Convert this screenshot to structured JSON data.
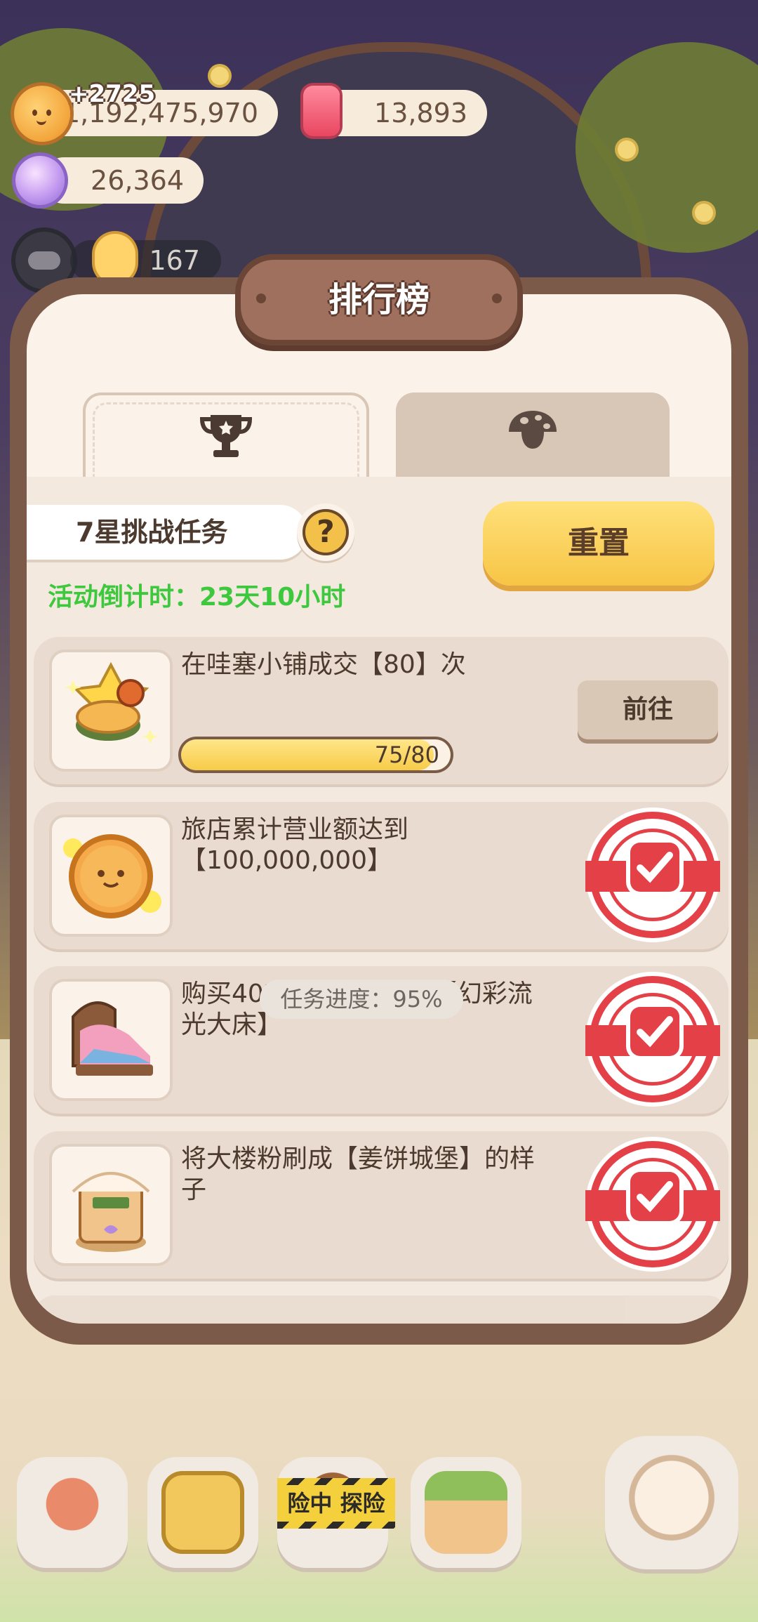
{
  "resources": {
    "coins": "1,192,475,970",
    "coin_gain": "+2725",
    "candles": "13,893",
    "gems": "26,364",
    "badge_count": "167"
  },
  "dialog": {
    "title": "排行榜",
    "tabs": [
      {
        "icon": "trophy-icon"
      },
      {
        "icon": "mushroom-icon"
      }
    ],
    "challenge": {
      "label": "7星挑战任务",
      "help": "?",
      "countdown": "活动倒计时：23天10小时",
      "reset_label": "重置"
    },
    "tasks": [
      {
        "desc": "在哇塞小铺成交【80】次",
        "action": "前往",
        "progress_text": "75/80",
        "progress": 0.9375,
        "status": "in-progress"
      },
      {
        "desc": "旅店累计营业额达到【100,000,000】",
        "status": "completed"
      },
      {
        "desc": "购买402号客房的家具【幻彩流光大床】",
        "status": "completed"
      },
      {
        "desc": "将大楼粉刷成【姜饼城堡】的样子",
        "status": "completed"
      }
    ],
    "overall_progress": "任务进度：95%"
  },
  "bottom_nav": {
    "adventure_banner": "险中 探险"
  },
  "colors": {
    "accent_yellow": "#f7c545",
    "countdown_green": "#3ec83e",
    "stamp_red": "#e44048",
    "frame_brown": "#7c5a4a"
  }
}
